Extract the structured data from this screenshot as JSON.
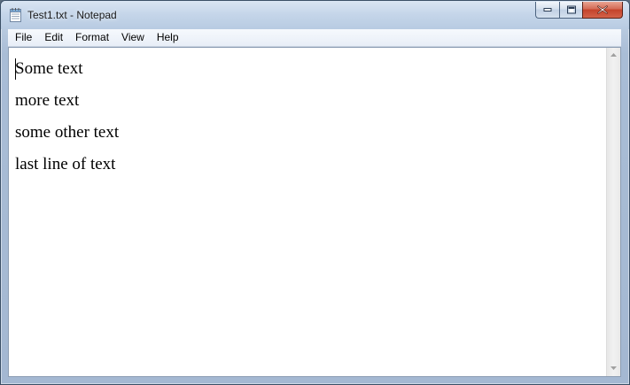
{
  "window": {
    "title": "Test1.txt - Notepad"
  },
  "menu": {
    "items": [
      {
        "label": "File"
      },
      {
        "label": "Edit"
      },
      {
        "label": "Format"
      },
      {
        "label": "View"
      },
      {
        "label": "Help"
      }
    ]
  },
  "editor": {
    "lines": [
      "Some text",
      "more text",
      "some other text",
      "last line of text"
    ]
  },
  "icons": {
    "app": "notepad-icon",
    "minimize": "minimize-icon",
    "maximize": "maximize-icon",
    "close": "close-icon",
    "scroll_up": "chevron-up-icon",
    "scroll_down": "chevron-down-icon"
  },
  "colors": {
    "close_button": "#c4432b",
    "frame": "#a9bdd6"
  }
}
